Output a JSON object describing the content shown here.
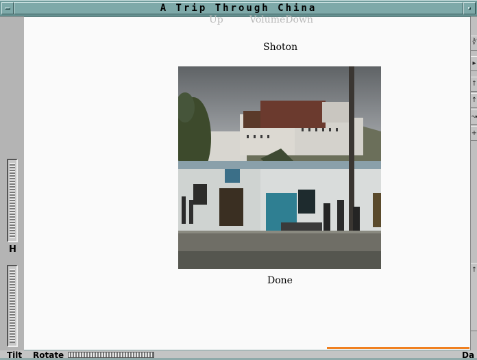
{
  "window": {
    "title": "A Trip Through China"
  },
  "content": {
    "volume_up": "Up",
    "volume_down": "VolumeDown",
    "shoton_label": "Shoton",
    "done_label": "Done"
  },
  "left_panel": {
    "h_label": "H"
  },
  "bottom_bar": {
    "tilt_label": "Tilt",
    "rotate_label": "Rotate",
    "right_fragment": "Da"
  },
  "colors": {
    "titlebar": "#7ea9a9",
    "frame": "#7ea3a3",
    "content_bg": "#fafafa",
    "accent_orange": "#f08020"
  }
}
